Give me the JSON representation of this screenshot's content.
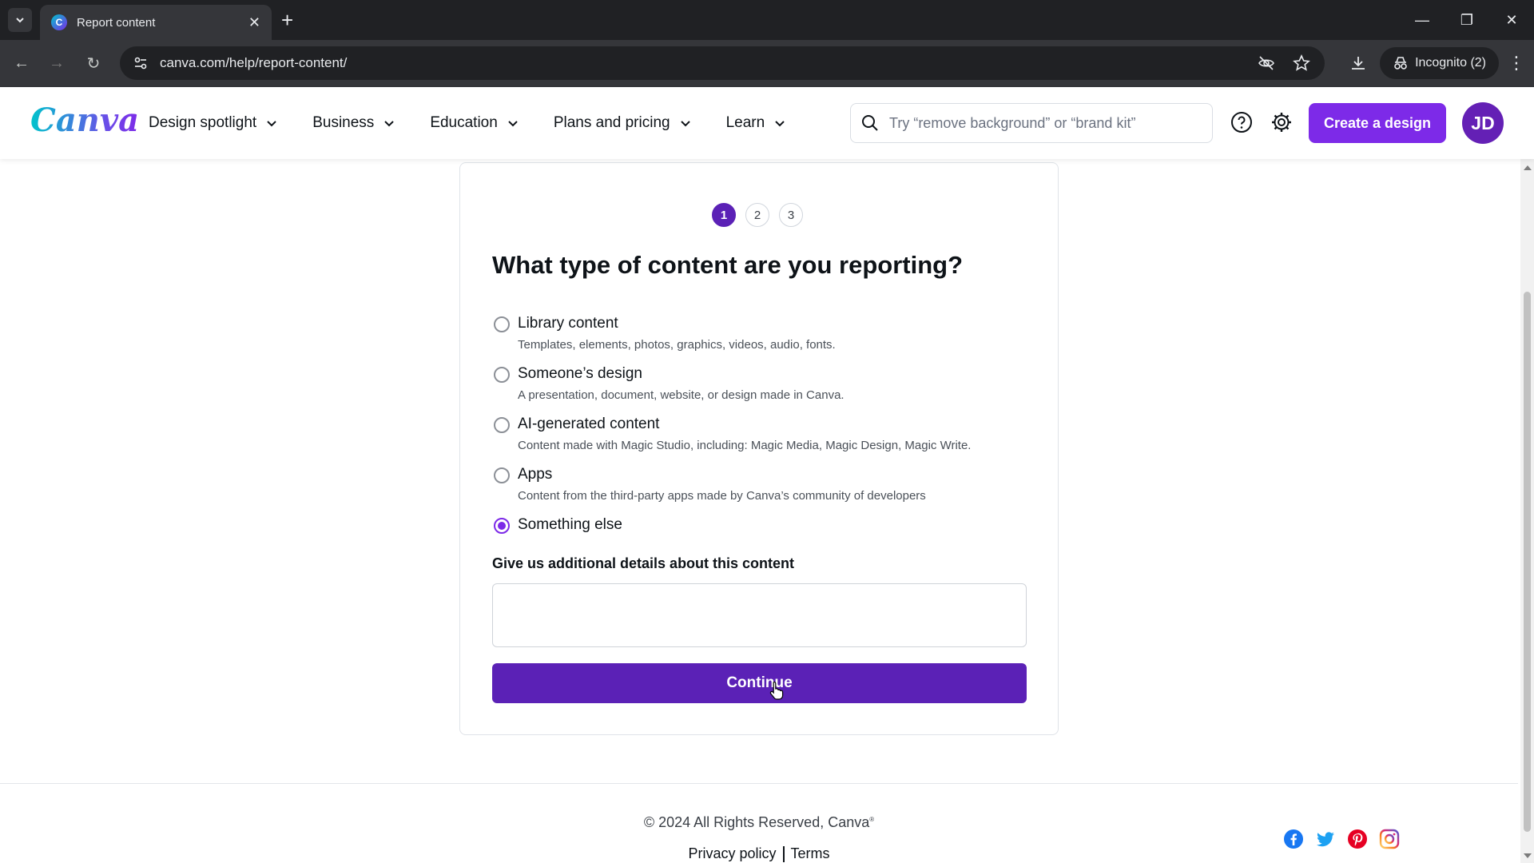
{
  "browser": {
    "tab_title": "Report content",
    "url": "canva.com/help/report-content/",
    "incognito_label": "Incognito (2)"
  },
  "header": {
    "logo": "Canva",
    "nav": [
      {
        "label": "Design spotlight"
      },
      {
        "label": "Business"
      },
      {
        "label": "Education"
      },
      {
        "label": "Plans and pricing"
      },
      {
        "label": "Learn"
      }
    ],
    "search_placeholder": "Try “remove background” or “brand kit”",
    "create_label": "Create a design",
    "avatar_initials": "JD",
    "accent": "#7d2ae8"
  },
  "form": {
    "steps": [
      "1",
      "2",
      "3"
    ],
    "active_step": "1",
    "question": "What type of content are you reporting?",
    "options": [
      {
        "label": "Library content",
        "description": "Templates, elements, photos, graphics, videos, audio, fonts.",
        "selected": false
      },
      {
        "label": "Someone’s design",
        "description": "A presentation, document, website, or design made in Canva.",
        "selected": false
      },
      {
        "label": "AI-generated content",
        "description": "Content made with Magic Studio, including: Magic Media, Magic Design, Magic Write.",
        "selected": false
      },
      {
        "label": "Apps",
        "description": "Content from the third-party apps made by Canva’s community of developers",
        "selected": false
      },
      {
        "label": "Something else",
        "description": "",
        "selected": true
      }
    ],
    "details_label": "Give us additional details about this content",
    "details_value": "",
    "continue_label": "Continue",
    "button_color": "#5b21b6"
  },
  "footer": {
    "copyright": "© 2024 All Rights Reserved, Canva",
    "copyright_mark": "®",
    "privacy_label": "Privacy policy",
    "terms_label": "Terms",
    "social": [
      "facebook-icon",
      "twitter-icon",
      "pinterest-icon",
      "instagram-icon"
    ]
  }
}
